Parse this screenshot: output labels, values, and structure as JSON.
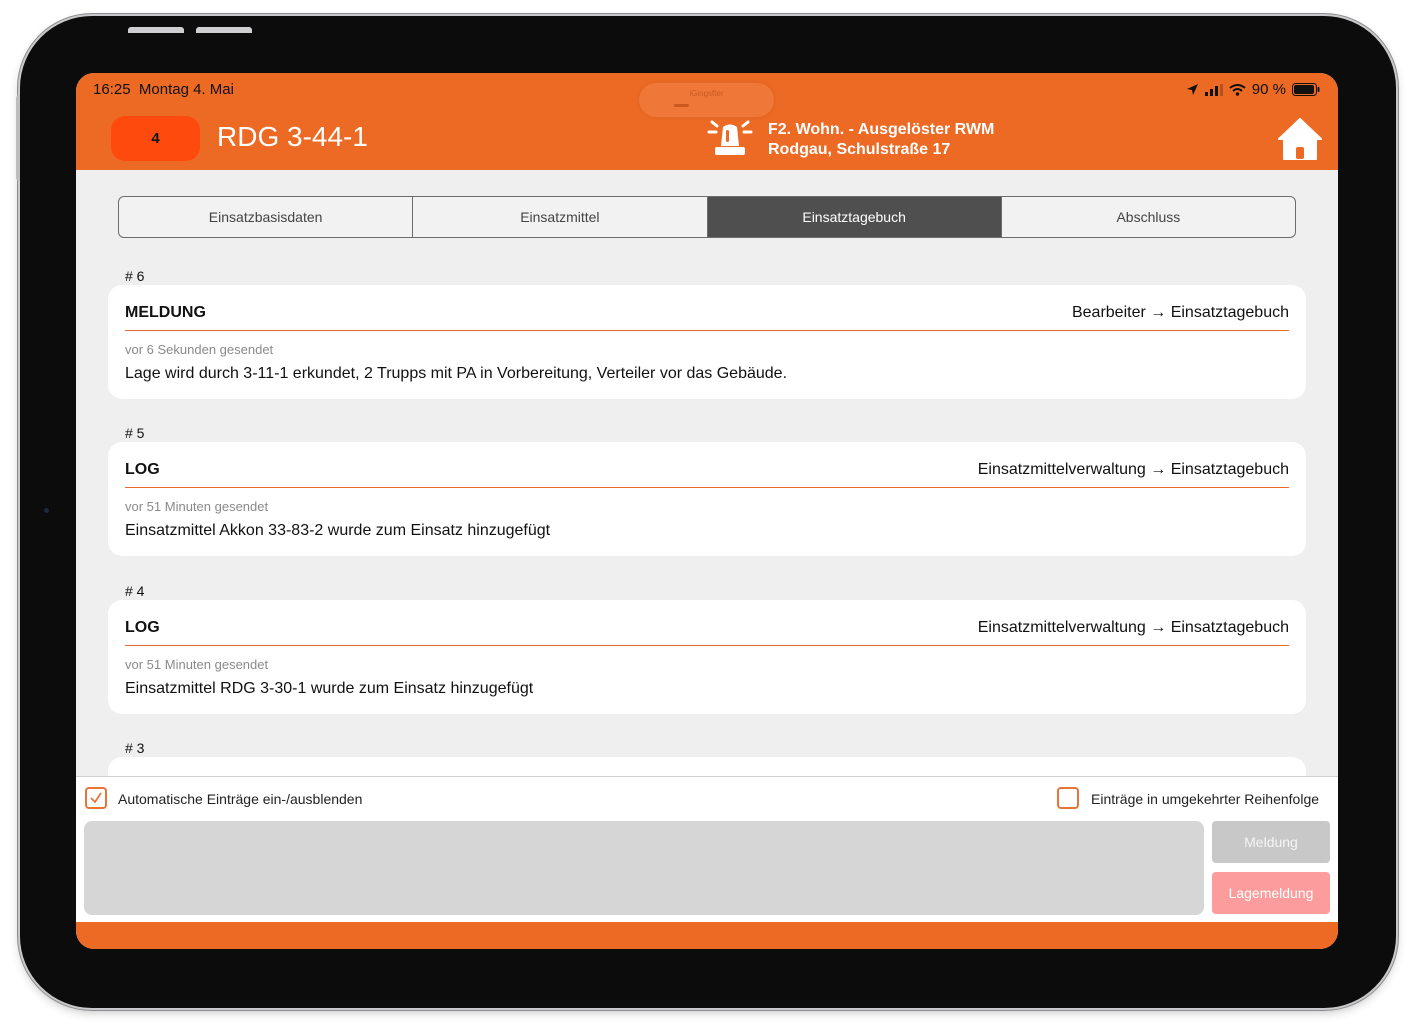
{
  "status": {
    "time": "16:25",
    "date": "Montag 4. Mai",
    "battery": "90 %",
    "pill_text": "iGingsfter"
  },
  "header": {
    "badge": "4",
    "unit": "RDG 3-44-1",
    "alarm_line1": "F2. Wohn. - Ausgelöster RWM",
    "alarm_line2": "Rodgau, Schulstraße 17"
  },
  "tabs": [
    {
      "label": "Einsatzbasisdaten",
      "active": false
    },
    {
      "label": "Einsatzmittel",
      "active": false
    },
    {
      "label": "Einsatztagebuch",
      "active": true
    },
    {
      "label": "Abschluss",
      "active": false
    }
  ],
  "entries": [
    {
      "num": "# 6",
      "type": "MELDUNG",
      "route": "Bearbeiter → Einsatztagebuch",
      "time": "vor 6 Sekunden gesendet",
      "message": "Lage wird durch 3-11-1 erkundet, 2 Trupps mit PA in Vorbereitung, Verteiler vor das Gebäude."
    },
    {
      "num": "# 5",
      "type": "LOG",
      "route": "Einsatzmittelverwaltung → Einsatztagebuch",
      "time": "vor 51 Minuten gesendet",
      "message": "Einsatzmittel Akkon 33-83-2 wurde zum Einsatz hinzugefügt"
    },
    {
      "num": "# 4",
      "type": "LOG",
      "route": "Einsatzmittelverwaltung → Einsatztagebuch",
      "time": "vor 51 Minuten gesendet",
      "message": "Einsatzmittel RDG 3-30-1 wurde zum Einsatz hinzugefügt"
    },
    {
      "num": "# 3"
    }
  ],
  "options": {
    "auto_entries_label": "Automatische Einträge ein-/ausblenden",
    "auto_entries_checked": true,
    "reverse_order_label": "Einträge in umgekehrter Reihenfolge",
    "reverse_order_checked": false
  },
  "compose": {
    "text": "",
    "meldung_button": "Meldung",
    "lagemeldung_button": "Lagemeldung"
  },
  "colors": {
    "brand": "#ec6a24",
    "badge": "#ff4a0e",
    "active_tab": "#4f4f4f"
  }
}
